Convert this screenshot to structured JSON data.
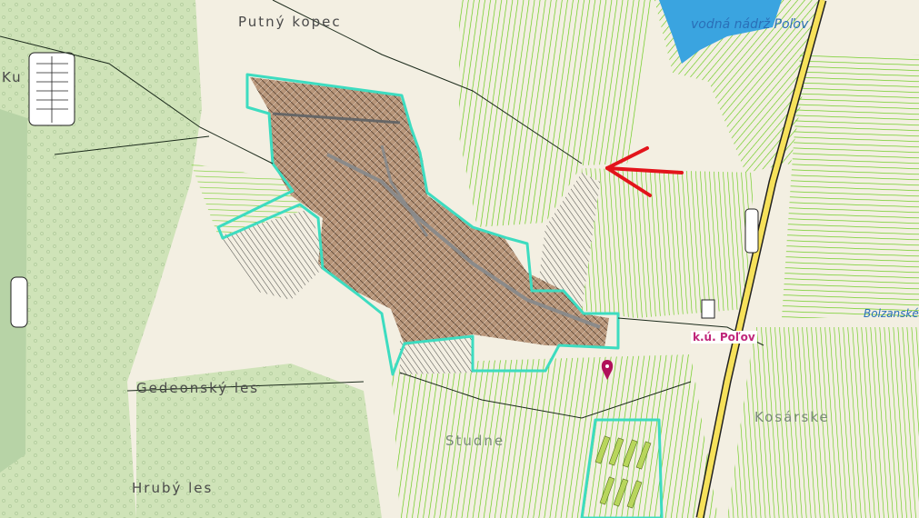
{
  "labels": {
    "putny_kopec": "Putný kopec",
    "kuzmice": "Ku",
    "vodna_nadrz": "vodná nádrž Poľov",
    "gedeonsky_les": "Gedeonský les",
    "hruby_les": "Hrubý les",
    "studne": "Studne",
    "kosarske": "Kosárske",
    "bolzanske": "Bolzanské",
    "cadastre_name": "k.ú. Poľov"
  },
  "colors": {
    "forest": "#cfe3b8",
    "meadow": "#f3efe2",
    "field_line": "#5dc80a",
    "parcel_outline": "#3ddcc0",
    "water": "#3aa4e0",
    "road": "#f6e15a",
    "built_up": "#b8967a",
    "arrow": "#e3141b",
    "marker": "#b0105a"
  },
  "icons": {
    "marker": "map-pin-icon",
    "arrow": "red-arrow-icon"
  }
}
